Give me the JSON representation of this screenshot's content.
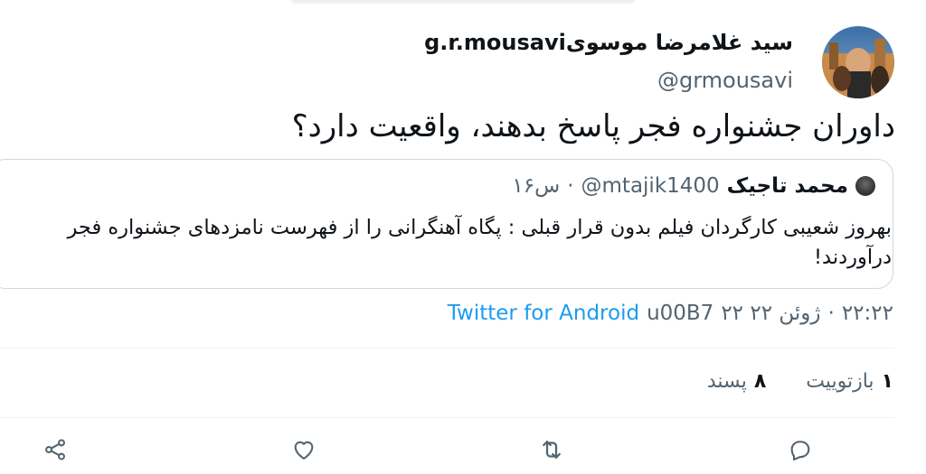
{
  "author": {
    "display_name": "g.r.mousaviسید غلامرضا موسوی",
    "handle": "@grmousavi"
  },
  "tweet": {
    "text": "داوران جشنواره فجر پاسخ بدهند، واقعیت دارد؟"
  },
  "quoted_tweet": {
    "name": "محمد تاجیک",
    "handle": "@mtajik1400",
    "separator": "·",
    "time": "۱۶س",
    "text": "بهروز شعیبی کارگردان فیلم بدون قرار قبلی : پگاه آهنگرانی را از فهرست نامزدهای جشنواره فجر درآوردند!"
  },
  "meta": {
    "time": "۲۲:۲۲",
    "separator": "·",
    "date": "۲۲ ژوئن ۲۲",
    "client_prefix": "u00B7",
    "client": "Twitter for Android"
  },
  "stats": {
    "retweets_count": "۱",
    "retweets_label": "بازتوییت",
    "likes_count": "۸",
    "likes_label": "پسند"
  },
  "actions": {
    "reply": "reply-icon",
    "retweet": "retweet-icon",
    "like": "heart-icon",
    "share": "share-icon"
  },
  "colors": {
    "accent": "#1d9bf0",
    "secondary_text": "#536471",
    "primary_text": "#0f1419",
    "border": "#cfd9de"
  }
}
